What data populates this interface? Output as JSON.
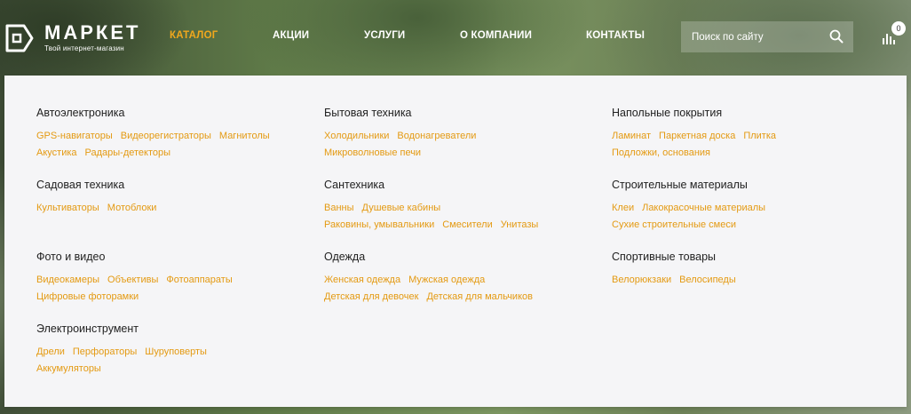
{
  "logo": {
    "title": "МАРКЕТ",
    "subtitle": "Твой интернет-магазин"
  },
  "nav": [
    {
      "label": "КАТАЛОГ",
      "active": true
    },
    {
      "label": "АКЦИИ",
      "active": false
    },
    {
      "label": "УСЛУГИ",
      "active": false
    },
    {
      "label": "О КОМПАНИИ",
      "active": false
    },
    {
      "label": "КОНТАКТЫ",
      "active": false
    }
  ],
  "search": {
    "placeholder": "Поиск по сайту",
    "value": ""
  },
  "cart": {
    "count": "0"
  },
  "colors": {
    "accent": "#f1a81d",
    "link": "#e49a12",
    "dropdown_bg": "#f5f5f7"
  },
  "catalog": {
    "columns": [
      [
        {
          "title": "Автоэлектроника",
          "rows": [
            [
              "GPS-навигаторы",
              "Видеорегистраторы",
              "Магнитолы"
            ],
            [
              "Акустика",
              "Радары-детекторы"
            ]
          ]
        },
        {
          "title": "Садовая техника",
          "rows": [
            [
              "Культиваторы",
              "Мотоблоки"
            ]
          ]
        },
        {
          "title": "Фото и видео",
          "rows": [
            [
              "Видеокамеры",
              "Объективы",
              "Фотоаппараты"
            ],
            [
              "Цифровые фоторамки"
            ]
          ]
        },
        {
          "title": "Электроинструмент",
          "rows": [
            [
              "Дрели",
              "Перфораторы",
              "Шуруповерты"
            ],
            [
              "Аккумуляторы"
            ]
          ]
        }
      ],
      [
        {
          "title": "Бытовая техника",
          "rows": [
            [
              "Холодильники",
              "Водонагреватели"
            ],
            [
              "Микроволновые печи"
            ]
          ]
        },
        {
          "title": "Сантехника",
          "rows": [
            [
              "Ванны",
              "Душевые кабины"
            ],
            [
              "Раковины, умывальники",
              "Смесители",
              "Унитазы"
            ]
          ]
        },
        {
          "title": "Одежда",
          "rows": [
            [
              "Женская одежда",
              "Мужская одежда"
            ],
            [
              "Детская для девочек",
              "Детская для мальчиков"
            ]
          ]
        }
      ],
      [
        {
          "title": "Напольные покрытия",
          "rows": [
            [
              "Ламинат",
              "Паркетная доска",
              "Плитка"
            ],
            [
              "Подложки, основания"
            ]
          ]
        },
        {
          "title": "Строительные материалы",
          "rows": [
            [
              "Клеи",
              "Лакокрасочные материалы"
            ],
            [
              "Сухие строительные смеси"
            ]
          ]
        },
        {
          "title": "Спортивные товары",
          "rows": [
            [
              "Велорюкзаки",
              "Велосипеды"
            ]
          ]
        }
      ]
    ]
  }
}
